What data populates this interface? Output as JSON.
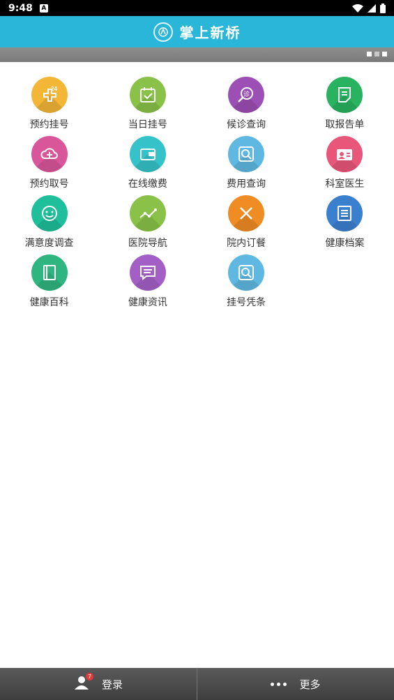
{
  "status_bar": {
    "time": "9:48",
    "notification": "A"
  },
  "header": {
    "title": "掌上新桥"
  },
  "banner": {
    "indicator_count": 3
  },
  "menu": [
    {
      "label": "预约挂号",
      "icon": "calendar-24-icon",
      "color": "#f3b637"
    },
    {
      "label": "当日挂号",
      "icon": "calendar-check-icon",
      "color": "#8ac249"
    },
    {
      "label": "候诊查询",
      "icon": "search-clinic-icon",
      "color": "#9c4fb5"
    },
    {
      "label": "取报告单",
      "icon": "report-doc-icon",
      "color": "#29b260"
    },
    {
      "label": "预约取号",
      "icon": "cloud-plus-icon",
      "color": "#d9569a"
    },
    {
      "label": "在线缴费",
      "icon": "wallet-icon",
      "color": "#35c3c9"
    },
    {
      "label": "费用查询",
      "icon": "search-icon",
      "color": "#5fb8e2"
    },
    {
      "label": "科室医生",
      "icon": "doctor-badge-icon",
      "color": "#e8567a"
    },
    {
      "label": "满意度调查",
      "icon": "smile-icon",
      "color": "#1fbf9b"
    },
    {
      "label": "医院导航",
      "icon": "route-icon",
      "color": "#8ac249"
    },
    {
      "label": "院内订餐",
      "icon": "cutlery-icon",
      "color": "#ef8c24"
    },
    {
      "label": "健康档案",
      "icon": "archive-icon",
      "color": "#3b7fcf"
    },
    {
      "label": "健康百科",
      "icon": "book-icon",
      "color": "#2fb57f"
    },
    {
      "label": "健康资讯",
      "icon": "message-icon",
      "color": "#a45fc7"
    },
    {
      "label": "挂号凭条",
      "icon": "search-icon",
      "color": "#5fb8e2"
    }
  ],
  "bottom_bar": {
    "login_label": "登录",
    "login_badge": "7",
    "more_label": "更多"
  }
}
